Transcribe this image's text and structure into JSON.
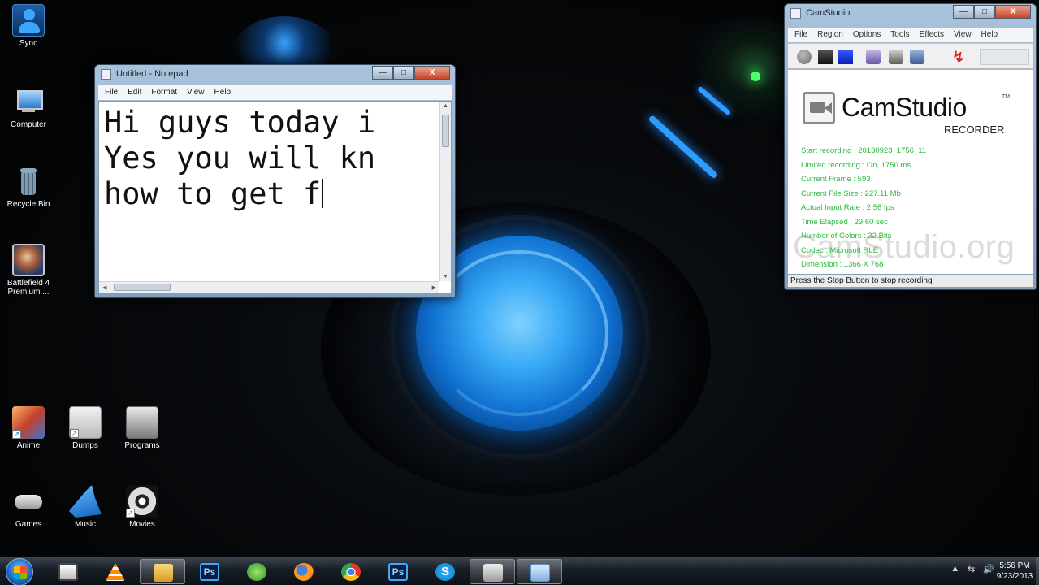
{
  "desktop": {
    "icons_left": [
      {
        "label": "Sync",
        "icon": "user-sync-icon"
      },
      {
        "label": "Computer",
        "icon": "computer-icon"
      },
      {
        "label": "Recycle Bin",
        "icon": "recycle-bin-icon"
      },
      {
        "label": "Battlefield 4 Premium ...",
        "icon": "battlefield-game-icon"
      }
    ],
    "icons_bottom": [
      {
        "label": "Anime",
        "icon": "anime-folder-icon"
      },
      {
        "label": "Dumps",
        "icon": "drive-icon"
      },
      {
        "label": "Programs",
        "icon": "drive-icon"
      },
      {
        "label": "Games",
        "icon": "gamepad-icon"
      },
      {
        "label": "Music",
        "icon": "music-icon"
      },
      {
        "label": "Movies",
        "icon": "film-reel-icon"
      }
    ]
  },
  "notepad": {
    "title": "Untitled - Notepad",
    "menu": [
      "File",
      "Edit",
      "Format",
      "View",
      "Help"
    ],
    "lines": [
      "Hi guys today i",
      "Yes you will kn",
      "how to get f"
    ]
  },
  "camstudio": {
    "title": "CamStudio",
    "menu": [
      "File",
      "Region",
      "Options",
      "Tools",
      "Effects",
      "View",
      "Help"
    ],
    "logo_name": "CamStudio",
    "logo_tm": "TM",
    "logo_sub": "RECORDER",
    "stats": [
      "Start recording : 20130923_1756_11",
      "Limited recording : On, 1750 ms",
      "Current Frame : 593",
      "Current File Size : 227.11 Mb",
      "Actual Input Rate : 2.56 fps",
      "Time Elapsed : 29.60 sec",
      "Number of Colors : 32 Bits",
      "Codec : Microsoft RLE",
      "Dimension : 1366 X 768"
    ],
    "watermark": "CamStudio.org",
    "status": "Press the Stop Button to stop recording"
  },
  "window_controls": {
    "minimize": "—",
    "maximize": "□",
    "close": "X"
  },
  "taskbar": {
    "items": [
      {
        "name": "media-center-icon"
      },
      {
        "name": "vlc-icon"
      },
      {
        "name": "windows-explorer-icon",
        "active": true
      },
      {
        "name": "photoshop-icon",
        "glyph": "Ps"
      },
      {
        "name": "utorrent-icon"
      },
      {
        "name": "firefox-icon"
      },
      {
        "name": "chrome-icon"
      },
      {
        "name": "photoshop-icon",
        "glyph": "Ps"
      },
      {
        "name": "skype-icon",
        "glyph": "S"
      },
      {
        "name": "camstudio-icon",
        "active": true
      },
      {
        "name": "notepad-icon",
        "active": true
      }
    ],
    "tray": [
      "▲",
      "⇆",
      "🔊"
    ],
    "time": "5:56 PM",
    "date": "9/23/2013"
  }
}
